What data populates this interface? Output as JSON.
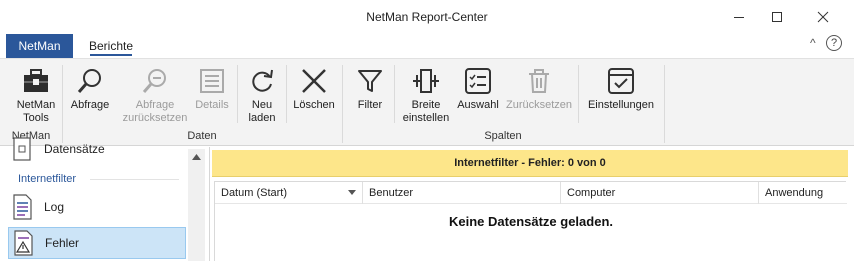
{
  "window": {
    "title": "NetMan Report-Center"
  },
  "ribbon_tabs": {
    "file": "NetMan",
    "active": "Berichte",
    "collapse": "^",
    "help": "?"
  },
  "ribbon": {
    "groups": {
      "netman": "NetMan",
      "daten": "Daten",
      "spalten": "Spalten"
    },
    "buttons": {
      "netman_tools": "NetMan\nTools",
      "abfrage": "Abfrage",
      "abfrage_reset": "Abfrage\nzurücksetzen",
      "details": "Details",
      "neu_laden": "Neu\nladen",
      "loeschen": "Löschen",
      "filter": "Filter",
      "breite": "Breite\neinstellen",
      "auswahl": "Auswahl",
      "zuruecksetzen": "Zurücksetzen",
      "einstellungen": "Einstellungen"
    }
  },
  "nav": {
    "partial_item": "Datensätze",
    "group": "Internetfilter",
    "items": [
      {
        "label": "Log",
        "icon": "log-document-icon"
      },
      {
        "label": "Fehler",
        "icon": "error-document-icon",
        "selected": true
      }
    ]
  },
  "main": {
    "banner": "Internetfilter - Fehler: 0 von 0",
    "columns": [
      "Datum (Start)",
      "Benutzer",
      "Computer",
      "Anwendung"
    ],
    "empty_message": "Keine Datensätze geladen."
  },
  "colors": {
    "accent": "#2b579a",
    "banner": "#fde68a",
    "selection": "#cce4f7"
  }
}
